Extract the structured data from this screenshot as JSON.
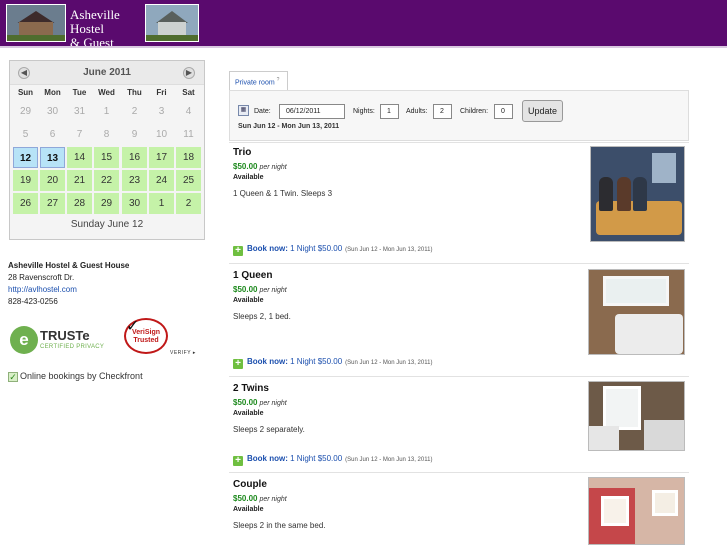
{
  "header": {
    "title_line1": "Asheville Hostel",
    "title_line2": "& Guest House",
    "bg_color": "#5a0a6e"
  },
  "calendar": {
    "month": "June 2011",
    "prev_icon": "arrow-left-icon",
    "next_icon": "arrow-right-icon",
    "weekdays": [
      "Sun",
      "Mon",
      "Tue",
      "Wed",
      "Thu",
      "Fri",
      "Sat"
    ],
    "weeks": [
      [
        "29",
        "30",
        "31",
        "1",
        "2",
        "3",
        "4"
      ],
      [
        "5",
        "6",
        "7",
        "8",
        "9",
        "10",
        "11"
      ],
      [
        "12",
        "13",
        "14",
        "15",
        "16",
        "17",
        "18"
      ],
      [
        "19",
        "20",
        "21",
        "22",
        "23",
        "24",
        "25"
      ],
      [
        "26",
        "27",
        "28",
        "29",
        "30",
        "1",
        "2"
      ]
    ],
    "selected_label": "Sunday June 12",
    "available_color": "#c5f2a8",
    "selected_color": "#b7e3f7"
  },
  "address": {
    "name": "Asheville Hostel & Guest House",
    "street": "28 Ravenscroft Dr.",
    "url": "http://avlhostel.com",
    "phone": "828-423-0256"
  },
  "badges": {
    "truste_letter": "e",
    "truste_name": "TRUSTe",
    "truste_sub": "CERTIFIED PRIVACY",
    "verisign_line1": "VeriSign",
    "verisign_line2": "Trusted",
    "verisign_verify": "VERIFY ▸",
    "checkfront": "Online bookings by Checkfront"
  },
  "booking": {
    "tab_label": "Private room",
    "tab_help": "?",
    "date_label": "Date:",
    "date_value": "06/12/2011",
    "nights_label": "Nights:",
    "nights_value": "1",
    "adults_label": "Adults:",
    "adults_value": "2",
    "children_label": "Children:",
    "children_value": "0",
    "update_label": "Update",
    "date_range": "Sun Jun 12 - Mon Jun 13, 2011"
  },
  "rooms": [
    {
      "name": "Trio",
      "price": "$50.00",
      "per": "per night",
      "status": "Available",
      "desc": "1 Queen & 1 Twin. Sleeps 3",
      "book": "Book now:",
      "nights": "1 Night $50.00",
      "range": "(Sun Jun 12 - Mon Jun 13, 2011)"
    },
    {
      "name": "1 Queen",
      "price": "$50.00",
      "per": "per night",
      "status": "Available",
      "desc": "Sleeps 2, 1 bed.",
      "book": "Book now:",
      "nights": "1 Night $50.00",
      "range": "(Sun Jun 12 - Mon Jun 13, 2011)"
    },
    {
      "name": "2 Twins",
      "price": "$50.00",
      "per": "per night",
      "status": "Available",
      "desc": "Sleeps 2 separately.",
      "book": "Book now:",
      "nights": "1 Night $50.00",
      "range": "(Sun Jun 12 - Mon Jun 13, 2011)"
    },
    {
      "name": "Couple",
      "price": "$50.00",
      "per": "per night",
      "status": "Available",
      "desc": "Sleeps 2 in the same bed."
    }
  ]
}
